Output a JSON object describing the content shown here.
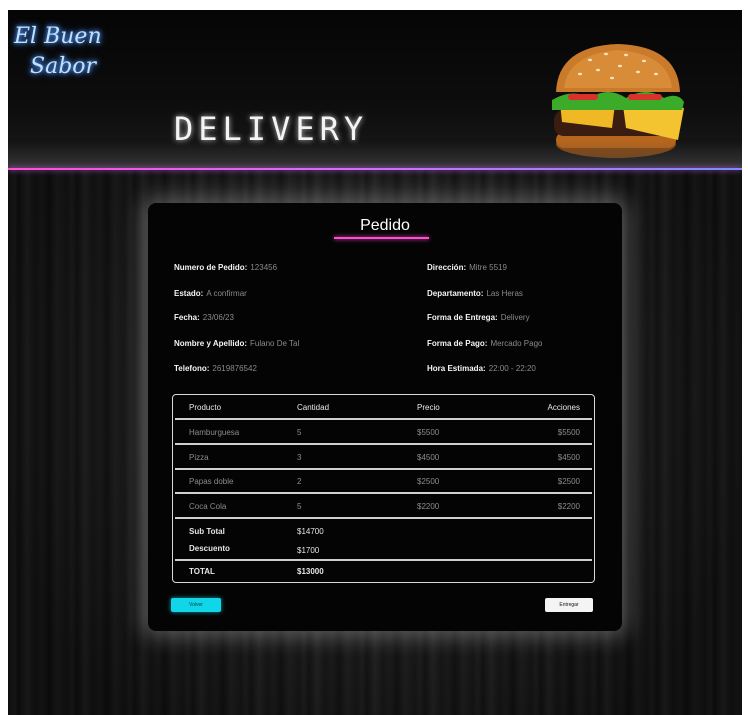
{
  "brand": {
    "logo_line1": "El Buen",
    "logo_line2": "Sabor",
    "section_title": "DELIVERY"
  },
  "order": {
    "title": "Pedido",
    "left": [
      {
        "label": "Numero de Pedido:",
        "value": "123456"
      },
      {
        "label": "Estado:",
        "value": "A confirmar"
      },
      {
        "label": "Fecha:",
        "value": "23/06/23"
      },
      {
        "label": "Nombre y Apellido:",
        "value": "Fulano De Tal"
      },
      {
        "label": "Telefono:",
        "value": "2619876542"
      }
    ],
    "right": [
      {
        "label": "Dirección:",
        "value": "Mitre 5519"
      },
      {
        "label": "Departamento:",
        "value": "Las Heras"
      },
      {
        "label": "Forma de Entrega:",
        "value": "Delivery"
      },
      {
        "label": "Forma de Pago:",
        "value": "Mercado Pago"
      },
      {
        "label": "Hora Estimada:",
        "value": "22:00 - 22:20"
      }
    ]
  },
  "table": {
    "headers": [
      "Producto",
      "Cantidad",
      "Precio",
      "Acciones"
    ],
    "rows": [
      [
        "Hamburguesa",
        "5",
        "$5500",
        "$5500"
      ],
      [
        "Pizza",
        "3",
        "$4500",
        "$4500"
      ],
      [
        "Papas doble",
        "2",
        "$2500",
        "$2500"
      ],
      [
        "Coca Cola",
        "5",
        "$2200",
        "$2200"
      ]
    ],
    "subtotal_label": "Sub Total",
    "subtotal_value": "$14700",
    "discount_label": "Descuento",
    "discount_value": "$1700",
    "total_label": "TOTAL",
    "total_value": "$13000"
  },
  "buttons": {
    "back": "Volver",
    "deliver": "Entregar"
  }
}
